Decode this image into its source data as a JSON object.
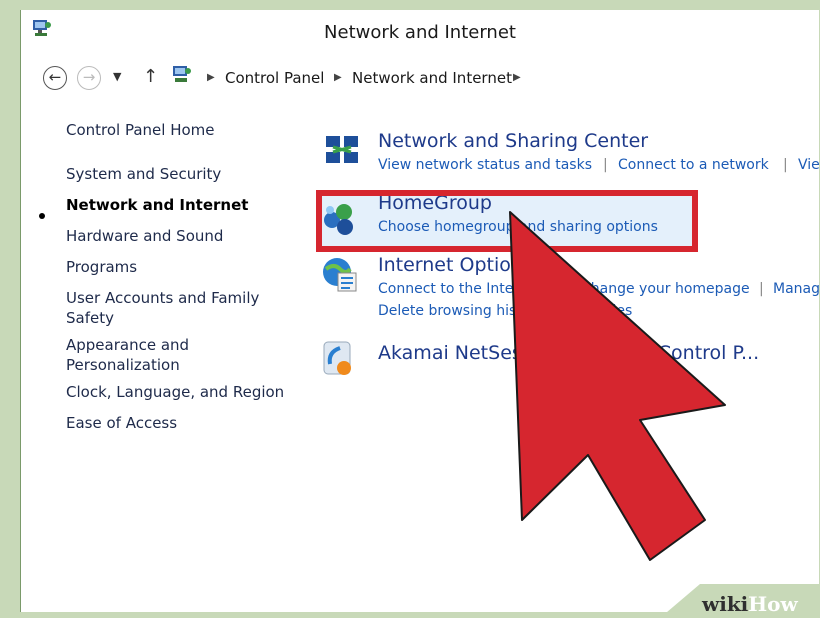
{
  "window": {
    "title": "Network and Internet"
  },
  "address": {
    "crumbs": [
      "Control Panel",
      "Network and Internet"
    ]
  },
  "sidebar": {
    "items": [
      {
        "label": "Control Panel Home"
      },
      {
        "label": "System and Security"
      },
      {
        "label": "Network and Internet",
        "active": true
      },
      {
        "label": "Hardware and Sound"
      },
      {
        "label": "Programs"
      },
      {
        "label": "User Accounts and Family",
        "label2": "Safety"
      },
      {
        "label": "Appearance and",
        "label2": "Personalization"
      },
      {
        "label": "Clock, Language, and Region"
      },
      {
        "label": "Ease of Access"
      }
    ]
  },
  "categories": [
    {
      "title": "Network and Sharing Center",
      "links": [
        "View network status and tasks",
        "Connect to a network",
        "Vie"
      ],
      "icon": "network-sharing-icon"
    },
    {
      "title": "HomeGroup",
      "links": [
        "Choose homegroup and sharing options"
      ],
      "icon": "homegroup-icon"
    },
    {
      "title": "Internet Options",
      "links": [
        "Connect to the Internet",
        "Change your homepage",
        "Manag",
        "Delete browsing history and cookies"
      ],
      "icon": "internet-options-icon"
    },
    {
      "title": "Akamai NetSession Interface Control P...",
      "links": [],
      "icon": "akamai-icon"
    }
  ],
  "colors": {
    "highlight_border": "#d6262f",
    "pointer_arrow": "#d6262f",
    "link": "#1c5bb6",
    "title": "#1e3a8a"
  },
  "watermark": {
    "text_a": "wiki",
    "text_b": "How"
  }
}
